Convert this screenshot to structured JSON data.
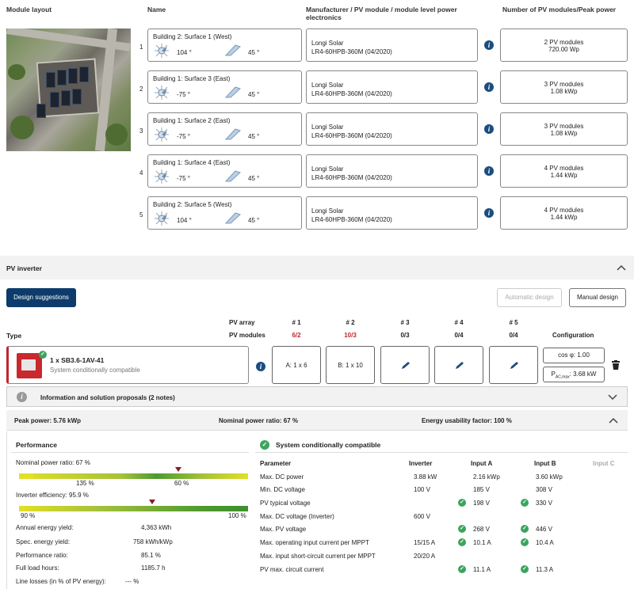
{
  "layout_header": {
    "module_layout": "Module layout",
    "name": "Name",
    "manufacturer": "Manufacturer / PV module / module level power electronics",
    "count": "Number of PV modules/Peak power"
  },
  "surfaces": [
    {
      "num": "1",
      "name": "Building 2: Surface 1 (West)",
      "azimuth": "104 °",
      "tilt": "45 °",
      "mfr": "Longi Solar",
      "model": "LR4-60HPB-360M (04/2020)",
      "modules": "2 PV modules",
      "power": "720.00 Wp"
    },
    {
      "num": "2",
      "name": "Building 1: Surface 3 (East)",
      "azimuth": "-75 °",
      "tilt": "45 °",
      "mfr": "Longi Solar",
      "model": "LR4-60HPB-360M (04/2020)",
      "modules": "3 PV modules",
      "power": "1.08 kWp"
    },
    {
      "num": "3",
      "name": "Building 1: Surface 2 (East)",
      "azimuth": "-75 °",
      "tilt": "45 °",
      "mfr": "Longi Solar",
      "model": "LR4-60HPB-360M (04/2020)",
      "modules": "3 PV modules",
      "power": "1.08 kWp"
    },
    {
      "num": "4",
      "name": "Building 1: Surface 4 (East)",
      "azimuth": "-75 °",
      "tilt": "45 °",
      "mfr": "Longi Solar",
      "model": "LR4-60HPB-360M (04/2020)",
      "modules": "4 PV modules",
      "power": "1.44 kWp"
    },
    {
      "num": "5",
      "name": "Building 2: Surface 5 (West)",
      "azimuth": "104 °",
      "tilt": "45 °",
      "mfr": "Longi Solar",
      "model": "LR4-60HPB-360M (04/2020)",
      "modules": "4 PV modules",
      "power": "1.44 kWp"
    }
  ],
  "inverter_section": {
    "title": "PV inverter",
    "design_suggestions": "Design suggestions",
    "automatic_design": "Automatic design",
    "manual_design": "Manual design",
    "type_label": "Type",
    "pv_array": "PV array",
    "pv_modules": "PV modules",
    "configuration": "Configuration",
    "inputs": [
      {
        "h": "# 1",
        "v": "6/2",
        "red": true,
        "box": "A: 1 x 6"
      },
      {
        "h": "# 2",
        "v": "10/3",
        "red": true,
        "box": "B: 1 x 10"
      },
      {
        "h": "# 3",
        "v": "0/3",
        "red": false,
        "box": ""
      },
      {
        "h": "# 4",
        "v": "0/4",
        "red": false,
        "box": ""
      },
      {
        "h": "# 5",
        "v": "0/4",
        "red": false,
        "box": ""
      }
    ],
    "inverter_name": "1 x SB3.6-1AV-41",
    "inverter_status": "System conditionally compatible",
    "cos_phi": "cos φ: 1.00",
    "pac_label": "P",
    "pac_sub": "AC,max",
    "pac_value": ": 3.68 kW",
    "info_notes": "Information and solution proposals (2 notes)"
  },
  "summary": {
    "peak_power": "Peak power: 5.76 kWp",
    "nominal_ratio": "Nominal power ratio: 67 %",
    "energy_usability": "Energy usability factor: 100 %"
  },
  "performance": {
    "title": "Performance",
    "nominal_label": "Nominal power ratio: 67 %",
    "bar1_left": "135 %",
    "bar1_right": "60 %",
    "efficiency_label": "Inverter efficiency: 95.9 %",
    "bar2_left": "90 %",
    "bar2_right": "100 %",
    "rows": [
      {
        "k": "Annual energy yield:",
        "v": "4,363 kWh"
      },
      {
        "k": "Spec. energy yield:",
        "v": "758 kWh/kWp"
      },
      {
        "k": "Performance ratio:",
        "v": "85.1 %"
      },
      {
        "k": "Full load hours:",
        "v": "1185.7 h"
      },
      {
        "k": "Line losses (in % of PV energy):",
        "v": "--- %"
      }
    ]
  },
  "compat": {
    "title": "System conditionally compatible",
    "headers": [
      "Parameter",
      "Inverter",
      "Input A",
      "Input B",
      "Input C"
    ],
    "rows": [
      {
        "p": "Max. DC power",
        "inv": "3.88 kW",
        "a": "2.16 kWp",
        "b": "3.60 kWp",
        "ok": false
      },
      {
        "p": "Min. DC voltage",
        "inv": "100 V",
        "a": "185 V",
        "b": "308 V",
        "ok": false
      },
      {
        "p": "PV typical voltage",
        "inv": "",
        "a": "198 V",
        "b": "330 V",
        "ok": true
      },
      {
        "p": "Max. DC voltage (Inverter)",
        "inv": "600 V",
        "a": "",
        "b": "",
        "ok": false
      },
      {
        "p": "Max. PV voltage",
        "inv": "",
        "a": "268 V",
        "b": "446 V",
        "ok": true
      },
      {
        "p": "Max. operating input current per MPPT",
        "inv": "15/15 A",
        "a": "10.1 A",
        "b": "10.4 A",
        "ok": true
      },
      {
        "p": "Max. input short-circuit current per MPPT",
        "inv": "20/20 A",
        "a": "",
        "b": "",
        "ok": false
      },
      {
        "p": "PV max. circuit current",
        "inv": "",
        "a": "11.1 A",
        "b": "11.3 A",
        "ok": true
      }
    ]
  },
  "colors": {
    "navy": "#0d3b6b",
    "red": "#c0262c",
    "green": "#3ba55d",
    "info": "#1a4e80"
  }
}
